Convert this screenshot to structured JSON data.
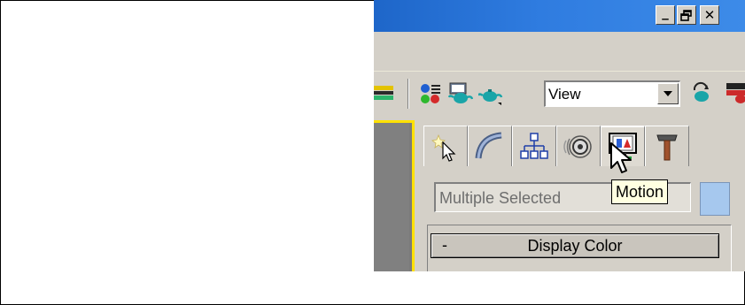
{
  "window": {
    "minimize_label": "_",
    "close_label": "✕"
  },
  "toolbar": {
    "view_select": {
      "value": "View"
    },
    "icons": [
      "layers-icon",
      "named-selection-icon",
      "teapot-render-icon",
      "teapot-quick-render-icon",
      "teapot-active-icon"
    ]
  },
  "command_panel": {
    "tabs": [
      {
        "name": "create",
        "icon": "create-star-cursor-icon"
      },
      {
        "name": "modify",
        "icon": "modify-arc-icon"
      },
      {
        "name": "hierarchy",
        "icon": "hierarchy-icon"
      },
      {
        "name": "motion",
        "icon": "motion-icon"
      },
      {
        "name": "display",
        "icon": "display-monitor-icon"
      },
      {
        "name": "utilities",
        "icon": "utilities-hammer-icon"
      }
    ],
    "name_field": {
      "value": "Multiple Selected"
    },
    "color_swatch": "#a6c8ee",
    "rollout": {
      "toggle": "-",
      "title": "Display Color"
    }
  },
  "tooltip": {
    "text": "Motion"
  },
  "colors": {
    "titlebar": "#2f7ce0",
    "panel_bg": "#d4d0c8",
    "viewport_border": "#ffe100",
    "tooltip_bg": "#ffffe1"
  }
}
